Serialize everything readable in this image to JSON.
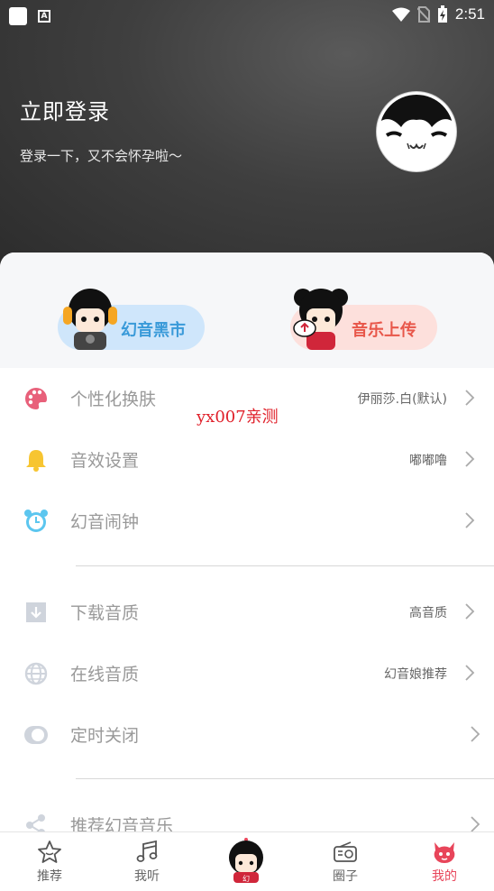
{
  "status_bar": {
    "time": "2:51"
  },
  "header": {
    "title": "立即登录",
    "subtitle": "登录一下，又不会怀孕啦～"
  },
  "promos": [
    {
      "label": "幻音黑市",
      "accent": "#3a9ad9"
    },
    {
      "label": "音乐上传",
      "accent": "#e8574a"
    }
  ],
  "settings": [
    {
      "label": "个性化换肤",
      "value": "伊丽莎.白(默认)",
      "icon": "palette-icon"
    },
    {
      "label": "音效设置",
      "value": "嘟嘟噜",
      "icon": "bell-icon"
    },
    {
      "label": "幻音闹钟",
      "value": "",
      "icon": "alarm-clock-icon"
    },
    {
      "label": "下载音质",
      "value": "高音质",
      "icon": "download-icon"
    },
    {
      "label": "在线音质",
      "value": "幻音娘推荐",
      "icon": "globe-icon"
    },
    {
      "label": "定时关闭",
      "value": "",
      "icon": "toggle-icon"
    },
    {
      "label": "推荐幻音音乐",
      "value": "",
      "icon": "share-icon"
    }
  ],
  "watermark": "yx007亲测",
  "tabs": [
    {
      "label": "推荐",
      "icon": "star-icon"
    },
    {
      "label": "我听",
      "icon": "music-note-icon"
    },
    {
      "label": "",
      "icon": "mascot-icon"
    },
    {
      "label": "圈子",
      "icon": "radio-icon"
    },
    {
      "label": "我的",
      "icon": "devil-face-icon",
      "active": true
    }
  ],
  "colors": {
    "accent": "#e8455a",
    "header_bg": "#3f3f3f"
  }
}
